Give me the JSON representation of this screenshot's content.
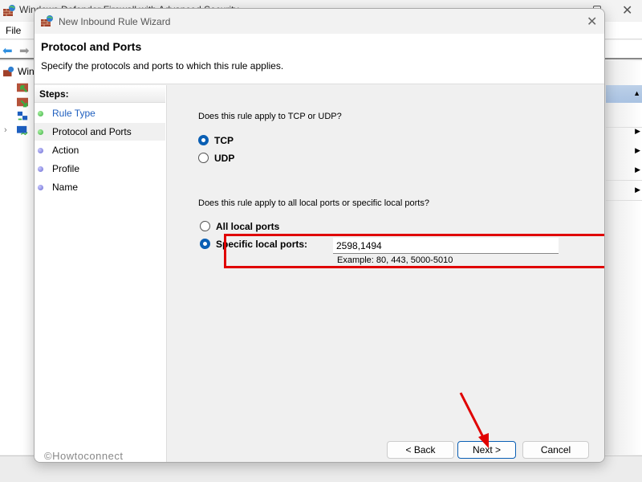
{
  "background_window": {
    "title": "Windows Defender Firewall with Advanced Security",
    "menu": [
      "File"
    ],
    "tree_root_label": "Win",
    "tree_chevron": "›"
  },
  "dialog": {
    "title": "New Inbound Rule Wizard",
    "close_glyph": "✕",
    "heading": "Protocol and Ports",
    "subheading": "Specify the protocols and ports to which this rule applies.",
    "steps_header": "Steps:",
    "steps": [
      {
        "label": "Rule Type",
        "state": "completed"
      },
      {
        "label": "Protocol and Ports",
        "state": "current"
      },
      {
        "label": "Action",
        "state": "pending"
      },
      {
        "label": "Profile",
        "state": "pending"
      },
      {
        "label": "Name",
        "state": "pending"
      }
    ],
    "protocol_question": "Does this rule apply to TCP or UDP?",
    "protocol_options": [
      {
        "label": "TCP",
        "checked": true
      },
      {
        "label": "UDP",
        "checked": false
      }
    ],
    "ports_question": "Does this rule apply to all local ports or specific local ports?",
    "port_options": [
      {
        "label": "All local ports",
        "checked": false
      },
      {
        "label": "Specific local ports:",
        "checked": true
      }
    ],
    "ports_value": "2598,1494",
    "ports_example": "Example: 80, 443, 5000-5010",
    "buttons": {
      "back": "< Back",
      "next": "Next >",
      "cancel": "Cancel"
    }
  },
  "annotation": {
    "highlight_color": "#e00000",
    "arrow_color": "#e00000"
  },
  "watermark": "©Howtoconnect",
  "colors": {
    "accent": "#0a5fb4",
    "step_completed": "#3cb043",
    "step_pending": "#6a6ad0"
  }
}
